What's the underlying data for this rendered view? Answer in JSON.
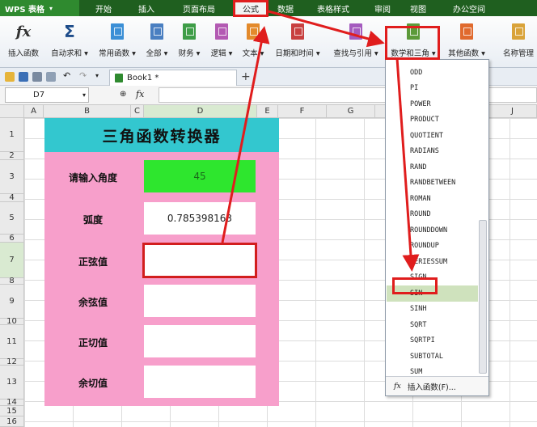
{
  "app": {
    "name": "WPS 表格"
  },
  "menu": [
    "开始",
    "插入",
    "页面布局",
    "公式",
    "数据",
    "表格样式",
    "审阅",
    "视图",
    "办公空间"
  ],
  "ribbon": {
    "insert_function": "插入函数",
    "autosum": "自动求和",
    "common": "常用函数",
    "all": "全部",
    "finance": "财务",
    "logic": "逻辑",
    "text": "文本",
    "datetime": "日期和时间",
    "lookup": "查找与引用",
    "math": "数学和三角",
    "other": "其他函数",
    "name_manager": "名称管理"
  },
  "tab": {
    "name": "Book1 *"
  },
  "formula_bar": {
    "cell_ref": "D7",
    "fx": "fx"
  },
  "columns": [
    "A",
    "B",
    "C",
    "D",
    "E",
    "F",
    "G",
    "H",
    "I",
    "J"
  ],
  "rows": [
    "1",
    "2",
    "3",
    "4",
    "5",
    "6",
    "7",
    "8",
    "9",
    "10",
    "11",
    "12",
    "13",
    "14",
    "15",
    "16"
  ],
  "sheet": {
    "title": "三角函数转换器",
    "rows": [
      {
        "label": "请输入角度",
        "value": "45"
      },
      {
        "label": "弧度",
        "value": "0.785398163"
      },
      {
        "label": "正弦值",
        "value": ""
      },
      {
        "label": "余弦值",
        "value": ""
      },
      {
        "label": "正切值",
        "value": ""
      },
      {
        "label": "余切值",
        "value": ""
      }
    ]
  },
  "dropdown": {
    "items": [
      "ODD",
      "PI",
      "POWER",
      "PRODUCT",
      "QUOTIENT",
      "RADIANS",
      "RAND",
      "RANDBETWEEN",
      "ROMAN",
      "ROUND",
      "ROUNDDOWN",
      "ROUNDUP",
      "SERIESSUM",
      "SIGN",
      "SIN",
      "SINH",
      "SQRT",
      "SQRTPI",
      "SUBTOTAL",
      "SUM"
    ],
    "footer": "插入函数(F)...",
    "highlighted": "SIN"
  },
  "colors": {
    "accent_red": "#e01d1d",
    "banner": "#33c7cf",
    "panel": "#f79fcb",
    "input_green": "#2ee62e",
    "menu_bg": "#1f5f1f"
  }
}
